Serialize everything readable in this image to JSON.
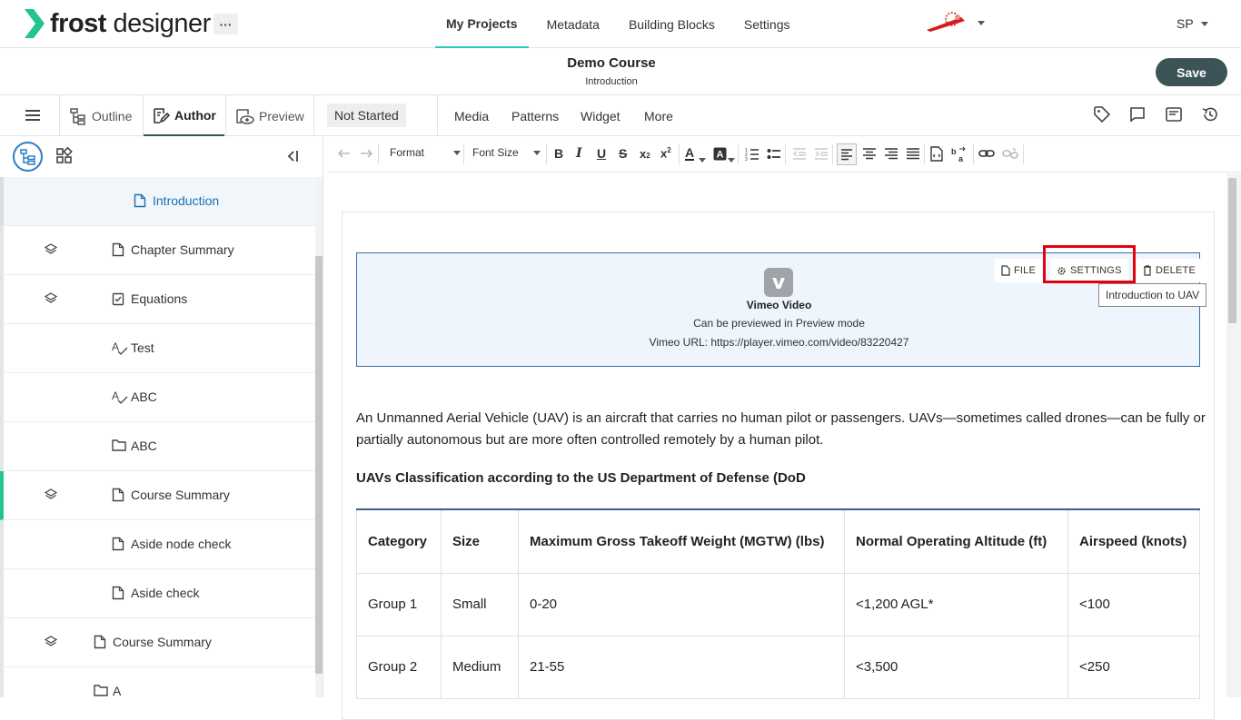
{
  "app": {
    "logo_bold": "frost",
    "logo_light": " designer",
    "more": "···",
    "nav_tabs": [
      "My Projects",
      "Metadata",
      "Building Blocks",
      "Settings"
    ],
    "user_initials": "SP"
  },
  "course": {
    "title": "Demo Course",
    "subtitle": "Introduction",
    "save_label": "Save"
  },
  "modebar": {
    "outline": "Outline",
    "author": "Author",
    "preview": "Preview",
    "status": "Not Started",
    "menu": [
      "Media",
      "Patterns",
      "Widget",
      "More"
    ]
  },
  "toolbar": {
    "format": "Format",
    "font_size": "Font Size"
  },
  "tree": [
    {
      "label": "Introduction",
      "icon": "page-icon",
      "active": true,
      "stack": false
    },
    {
      "label": "Chapter Summary",
      "icon": "page-icon",
      "stack": true
    },
    {
      "label": "Equations",
      "icon": "checklist-icon",
      "stack": true
    },
    {
      "label": "Test",
      "icon": "spellcheck-icon",
      "stack": false
    },
    {
      "label": "ABC",
      "icon": "spellcheck-icon",
      "stack": false
    },
    {
      "label": "ABC",
      "icon": "folder-icon",
      "stack": false
    },
    {
      "label": "Course Summary",
      "icon": "page-icon",
      "stack": true,
      "green": true
    },
    {
      "label": "Aside node check",
      "icon": "page-icon",
      "stack": false
    },
    {
      "label": "Aside check",
      "icon": "page-icon",
      "stack": false
    },
    {
      "label": "Course Summary",
      "icon": "page-icon",
      "stack": true
    },
    {
      "label": "A",
      "icon": "folder-icon",
      "stack": false
    }
  ],
  "vimeo": {
    "file": "FILE",
    "settings": "SETTINGS",
    "delete": "DELETE",
    "tooltip": "Introduction to UAV",
    "title": "Vimeo Video",
    "preview_note": "Can be previewed in Preview mode",
    "url_line": "Vimeo URL: https://player.vimeo.com/video/83220427"
  },
  "content": {
    "paragraph": "An Unmanned Aerial Vehicle (UAV) is an aircraft that carries no human pilot or passengers. UAVs—sometimes called drones—can be fully or partially autonomous but are more often controlled remotely by a human pilot.",
    "heading": "UAVs Classification according to the US Department of Defense (DoD",
    "table": {
      "headers": [
        "Category",
        "Size",
        "Maximum Gross Takeoff Weight (MGTW) (lbs)",
        "Normal Operating Altitude (ft)",
        "Airspeed (knots)"
      ],
      "rows": [
        [
          "Group 1",
          "Small",
          "0-20",
          "<1,200 AGL*",
          "<100"
        ],
        [
          "Group 2",
          "Medium",
          "21-55",
          "<3,500",
          "<250"
        ]
      ]
    }
  },
  "colors": {
    "accent_teal": "#2ec6c0",
    "save_bg": "#3c5457",
    "link_blue": "#1e6fb0",
    "highlight_red": "#e4000f",
    "tree_green": "#24c48c"
  }
}
